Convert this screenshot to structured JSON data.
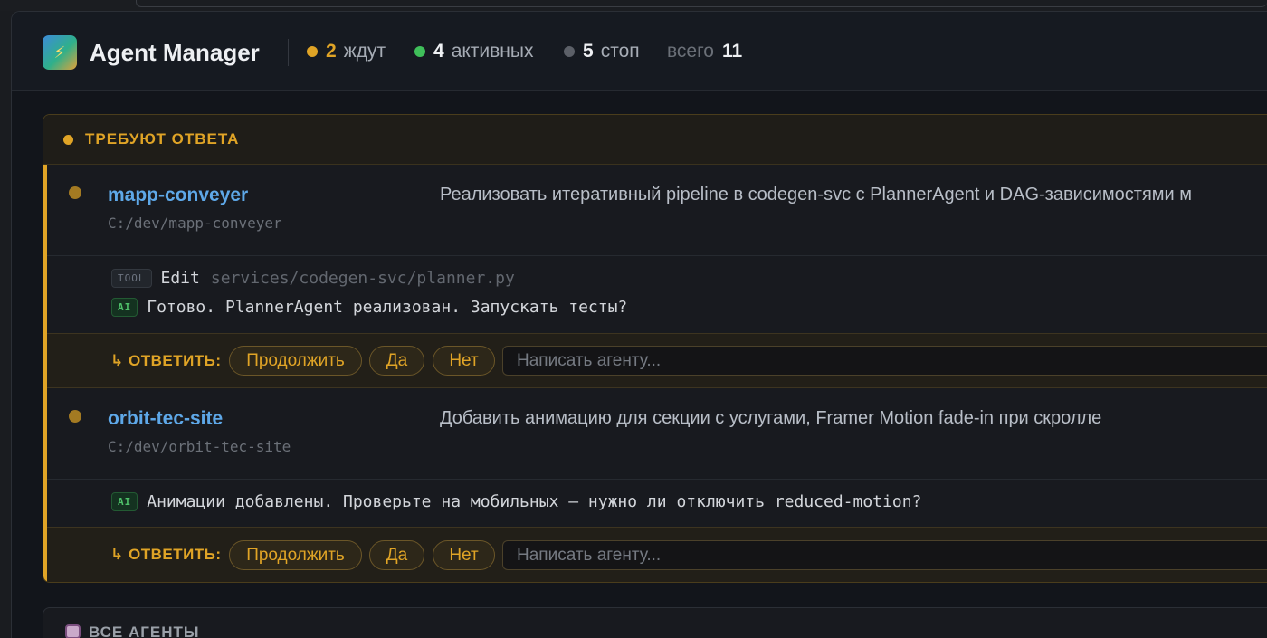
{
  "app": {
    "title": "Agent Manager",
    "logo_icon": "bolt-icon"
  },
  "stats": {
    "waiting": {
      "count": "2",
      "label": "ждут",
      "color": "#e0a426"
    },
    "active": {
      "count": "4",
      "label": "активных",
      "color": "#3fbf5a"
    },
    "stopped": {
      "count": "5",
      "label": "стоп",
      "color": "#5c6068"
    },
    "total": {
      "label": "всего",
      "count": "11"
    }
  },
  "needs_answer": {
    "title": "ТРЕБУЮТ ОТВЕТА",
    "agents": [
      {
        "name": "mapp-conveyer",
        "path": "C:/dev/mapp-conveyer",
        "task": "Реализовать итеративный pipeline в codegen-svc с PlannerAgent и DAG-зависимостями м",
        "tool": {
          "tag": "TOOL",
          "name": "Edit",
          "arg": "services/codegen-svc/planner.py"
        },
        "ai": {
          "tag": "AI",
          "text": "Готово. PlannerAgent реализован. Запускать тесты?"
        },
        "reply": {
          "label": "↳ ОТВЕТИТЬ:",
          "buttons": [
            "Продолжить",
            "Да",
            "Нет"
          ],
          "placeholder": "Написать агенту..."
        }
      },
      {
        "name": "orbit-tec-site",
        "path": "C:/dev/orbit-tec-site",
        "task": "Добавить анимацию для секции с услугами, Framer Motion fade-in при скролле",
        "ai": {
          "tag": "AI",
          "text": "Анимации добавлены. Проверьте на мобильных — нужно ли отключить reduced-motion?"
        },
        "reply": {
          "label": "↳ ОТВЕТИТЬ:",
          "buttons": [
            "Продолжить",
            "Да",
            "Нет"
          ],
          "placeholder": "Написать агенту..."
        }
      }
    ]
  },
  "all_agents": {
    "title": "ВСЕ АГЕНТЫ",
    "icon": "robot-icon"
  }
}
